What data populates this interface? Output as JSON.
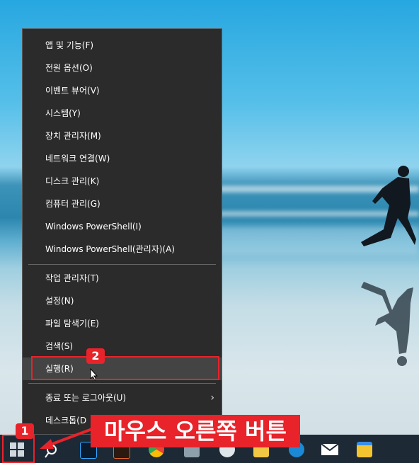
{
  "menu": {
    "items": [
      {
        "label": "앱 및 기능(F)"
      },
      {
        "label": "전원 옵션(O)"
      },
      {
        "label": "이벤트 뷰어(V)"
      },
      {
        "label": "시스템(Y)"
      },
      {
        "label": "장치 관리자(M)"
      },
      {
        "label": "네트워크 연결(W)"
      },
      {
        "label": "디스크 관리(K)"
      },
      {
        "label": "컴퓨터 관리(G)"
      },
      {
        "label": "Windows PowerShell(I)"
      },
      {
        "label": "Windows PowerShell(관리자)(A)"
      },
      {
        "label": "작업 관리자(T)"
      },
      {
        "label": "설정(N)"
      },
      {
        "label": "파일 탐색기(E)"
      },
      {
        "label": "검색(S)"
      },
      {
        "label": "실행(R)"
      },
      {
        "label": "종료 또는 로그아웃(U)"
      },
      {
        "label": "데스크톱(D"
      }
    ],
    "submenu_arrow": "›"
  },
  "annotations": {
    "badge1": "1",
    "badge2": "2",
    "callout": "마우스 오른쪽 버튼",
    "accent_color": "#e8232a"
  },
  "taskbar": {
    "icons": [
      "windows-start-icon",
      "search-icon",
      "photoshop-icon",
      "app-icon",
      "chrome-icon",
      "files-icon",
      "steam-icon",
      "folder-icon",
      "edge-icon",
      "mail-icon",
      "file-explorer-icon"
    ]
  }
}
